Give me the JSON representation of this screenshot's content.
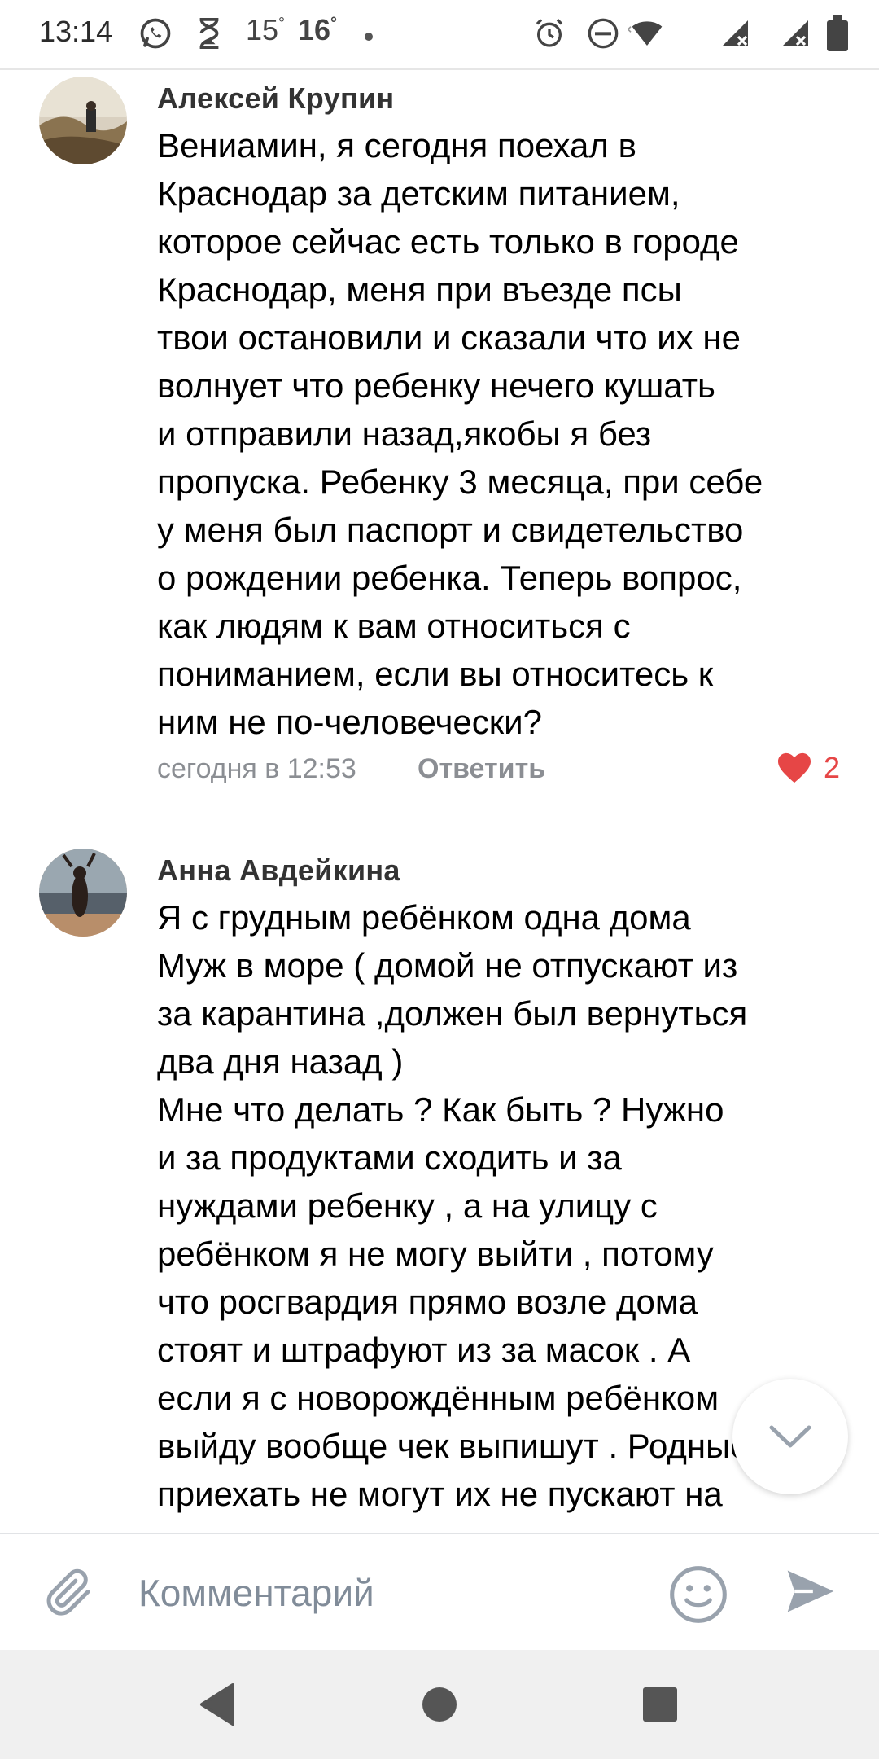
{
  "status_bar": {
    "time": "13:14",
    "temp1": "15",
    "temp2": "16",
    "degree": "°",
    "icons": [
      "whatsapp-icon",
      "hourglass-icon",
      "alarm-icon",
      "do-not-disturb-icon",
      "wifi-icon",
      "signal-icon",
      "signal-icon",
      "battery-icon"
    ]
  },
  "comments": [
    {
      "author": "Алексей Крупин",
      "text": "Вениамин, я сегодня поехал в\nКраснодар за детским питанием,\nкоторое сейчас есть только в городе\nКраснодар, меня при въезде псы\nтвои остановили и сказали что их не\nволнует что ребенку нечего кушать\nи отправили назад,якобы я без\nпропуска. Ребенку 3 месяца, при себе\nу меня был паспорт и свидетельство\nо рождении ребенка. Теперь вопрос,\nкак людям к вам относиться с\nпониманием, если вы относитесь к\nним не по-человечески?",
      "time": "сегодня в 12:53",
      "reply": "Ответить",
      "likes": "2"
    },
    {
      "author": "Анна Авдейкина",
      "text": "Я с грудным ребёнком одна дома\nМуж в море ( домой не отпускают из\nза карантина ,должен был вернуться\nдва дня назад )\nМне что делать ? Как быть ? Нужно\nи за продуктами сходить и за\nнуждами ребенку , а на улицу с\nребёнком я не могу выйти , потому\nчто росгвардия прямо возле дома\nстоят и штрафуют из за масок . А\nесли я с новорождённым ребёнком\nвыйду вообще чек выпишут . Родные\nприехать не могут их не пускают на"
    }
  ],
  "input": {
    "placeholder": "Комментарий"
  },
  "colors": {
    "accent": "#e64646",
    "muted": "#8b8e93",
    "icon": "#99a2ad"
  }
}
